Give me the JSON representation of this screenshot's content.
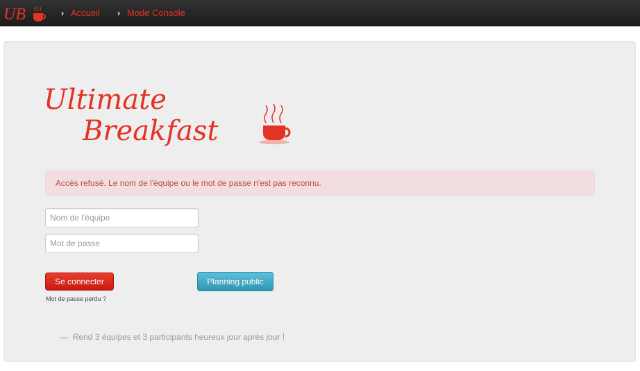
{
  "navbar": {
    "brand_text": "UB",
    "items": [
      {
        "label": "Accueil",
        "icon": "chevron-right-icon"
      },
      {
        "label": "Mode Console",
        "icon": "chevron-right-icon"
      }
    ]
  },
  "logo": {
    "line1": "Ultimate",
    "line2": "Breakfast",
    "icon": "steaming-cup-icon"
  },
  "alert": {
    "message": "Accès refusé. Le nom de l'équipe ou le mot de passe n'est pas reconnu."
  },
  "form": {
    "team_placeholder": "Nom de l'équipe",
    "team_value": "",
    "password_placeholder": "Mot de passe",
    "password_value": "",
    "login_button": "Se connecter",
    "lost_password": "Mot de passe perdu ?",
    "planning_button": "Planning public"
  },
  "footer_quote": {
    "dash": "—",
    "text": "Rend 3 équipes et 3 participants heureux jour après jour !"
  },
  "colors": {
    "accent_red": "#e43224",
    "navbar_bg": "#222222",
    "alert_bg": "#f2dede",
    "alert_text": "#b94a48",
    "info_button": "#49afcd"
  }
}
